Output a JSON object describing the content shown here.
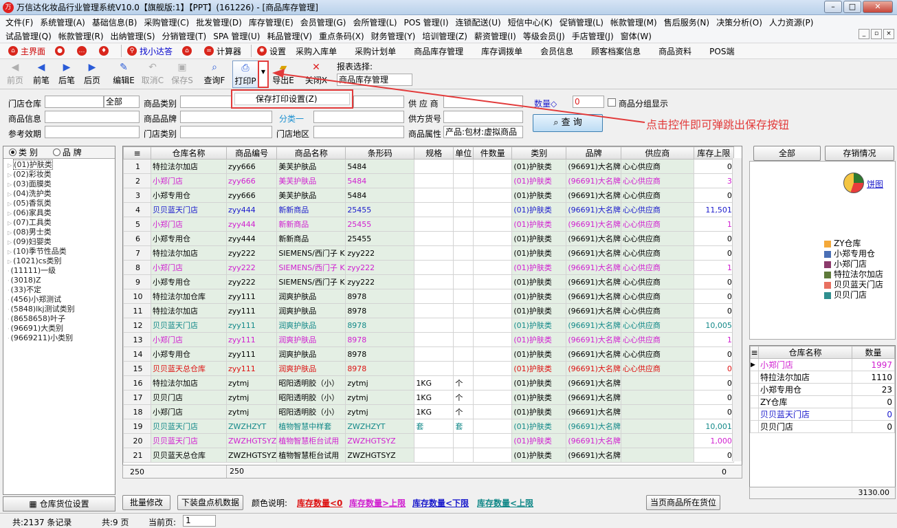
{
  "window": {
    "title": "万信达化妆品行业管理系统V10.0【旗舰版:1】【PPT】(161226) - [商品库存管理]",
    "logo_text": "万"
  },
  "menu_row1": [
    "文件(F)",
    "系统管理(A)",
    "基础信息(B)",
    "采购管理(C)",
    "批发管理(D)",
    "库存管理(E)",
    "会员管理(G)",
    "会所管理(L)",
    "POS 管理(I)",
    "连锁配送(U)",
    "短信中心(K)",
    "促销管理(L)",
    "帐款管理(M)",
    "售后服务(N)",
    "决策分析(O)",
    "人力资源(P)"
  ],
  "menu_row2": [
    "试品管理(Q)",
    "帐款管理(R)",
    "出纳管理(S)",
    "分销管理(T)",
    "SPA 管理(U)",
    "耗品管理(V)",
    "重点条码(X)",
    "财务管理(Y)",
    "培训管理(Z)",
    "薪资管理(I)",
    "等级会员(J)",
    "手店管理(J)",
    "窗体(W)"
  ],
  "quickbar": {
    "home": "主界面",
    "finder": "找小达答",
    "calc": "计算器",
    "settings": "设置",
    "links": [
      "采购入库单",
      "采购计划单",
      "商品库存管理",
      "库存调拨单",
      "会员信息",
      "顾客档案信息",
      "商品资料",
      "POS端"
    ]
  },
  "toolbar": {
    "first": "前页",
    "prev": "前笔",
    "next": "后笔",
    "last": "后页",
    "edit": "编辑E",
    "cancel": "取消C",
    "save": "保存S",
    "query": "查询F",
    "print": "打印P",
    "export": "导出E",
    "close": "关闭X",
    "report_label": "报表选择:",
    "report_value": "商品库存管理"
  },
  "popup": {
    "save_print": "保存打印设置(Z)"
  },
  "annotation": "点击控件即可弹跳出保存按钮",
  "form": {
    "store_label": "门店仓库",
    "store_scope": "全部",
    "cat_label": "商品类别",
    "supplier_label": "供 应 商",
    "qty_label": "数量◇",
    "qty_value": "0",
    "group_label": "商品分组显示",
    "info_label": "商品信息",
    "brand_label": "商品品牌",
    "class_link": "分类一",
    "supcode_label": "供方货号",
    "expiry_label": "参考效期",
    "storecat_label": "门店类别",
    "region_label": "门店地区",
    "attr_label": "商品属性",
    "attr_value": "产品:包材:虚拟商品",
    "query_btn": "查 询"
  },
  "left_panel": {
    "radio_category": "类 别",
    "radio_brand": "品 牌",
    "tree": [
      "(01)护肤类",
      "(02)彩妆类",
      "(03)面膜类",
      "(04)洗护类",
      "(05)香氛类",
      "(06)家具类",
      "(07)工具类",
      "(08)男士类",
      "(09)妇婴类",
      "(10)季节性品类",
      "(1021)cs类别",
      "(11111)一级",
      "(3018)Z",
      "(33)不定",
      "(456)小郑测试",
      "(5848)lkj测试类别",
      "(8658658)叶子",
      "(96691)大类别",
      "(9669211)小类别"
    ],
    "bottom_btn": "仓库货位设置"
  },
  "grid": {
    "columns": [
      "",
      "仓库名称",
      "商品编号",
      "商品名称",
      "条形码",
      "规格",
      "单位",
      "件数量",
      "类别",
      "品牌",
      "供应商",
      "库存上限"
    ],
    "rows": [
      {
        "n": "1",
        "store": "特拉法尔加店",
        "code": "zyy666",
        "name": "美芙护肤品",
        "bar": "5484",
        "spec": "",
        "unit": "",
        "pcs": "",
        "cat": "(01)护肤类",
        "brand": "(96691)大名牌",
        "sup": "心心供应商",
        "max": "0",
        "color": "#000000"
      },
      {
        "n": "2",
        "store": "小郑门店",
        "code": "zyy666",
        "name": "美芙护肤品",
        "bar": "5484",
        "spec": "",
        "unit": "",
        "pcs": "",
        "cat": "(01)护肤类",
        "brand": "(96691)大名牌",
        "sup": "心心供应商",
        "max": "3",
        "color": "#d020d0"
      },
      {
        "n": "3",
        "store": "小郑专用仓",
        "code": "zyy666",
        "name": "美芙护肤品",
        "bar": "5484",
        "spec": "",
        "unit": "",
        "pcs": "",
        "cat": "(01)护肤类",
        "brand": "(96691)大名牌",
        "sup": "心心供应商",
        "max": "0",
        "color": "#000000"
      },
      {
        "n": "4",
        "store": "贝贝蓝天门店",
        "code": "zyy444",
        "name": "新新商品",
        "bar": "25455",
        "spec": "",
        "unit": "",
        "pcs": "",
        "cat": "(01)护肤类",
        "brand": "(96691)大名牌",
        "sup": "心心供应商",
        "max": "11,501",
        "color": "#1a1acc"
      },
      {
        "n": "5",
        "store": "小郑门店",
        "code": "zyy444",
        "name": "新新商品",
        "bar": "25455",
        "spec": "",
        "unit": "",
        "pcs": "",
        "cat": "(01)护肤类",
        "brand": "(96691)大名牌",
        "sup": "心心供应商",
        "max": "1",
        "color": "#d020d0"
      },
      {
        "n": "6",
        "store": "小郑专用仓",
        "code": "zyy444",
        "name": "新新商品",
        "bar": "25455",
        "spec": "",
        "unit": "",
        "pcs": "",
        "cat": "(01)护肤类",
        "brand": "(96691)大名牌",
        "sup": "心心供应商",
        "max": "0",
        "color": "#000000"
      },
      {
        "n": "7",
        "store": "特拉法尔加店",
        "code": "zyy222",
        "name": "SIEMENS/西门子 K",
        "bar": "zyy222",
        "spec": "",
        "unit": "",
        "pcs": "",
        "cat": "(01)护肤类",
        "brand": "(96691)大名牌",
        "sup": "心心供应商",
        "max": "0",
        "color": "#000000"
      },
      {
        "n": "8",
        "store": "小郑门店",
        "code": "zyy222",
        "name": "SIEMENS/西门子 K",
        "bar": "zyy222",
        "spec": "",
        "unit": "",
        "pcs": "",
        "cat": "(01)护肤类",
        "brand": "(96691)大名牌",
        "sup": "心心供应商",
        "max": "1",
        "color": "#d020d0"
      },
      {
        "n": "9",
        "store": "小郑专用仓",
        "code": "zyy222",
        "name": "SIEMENS/西门子 K",
        "bar": "zyy222",
        "spec": "",
        "unit": "",
        "pcs": "",
        "cat": "(01)护肤类",
        "brand": "(96691)大名牌",
        "sup": "心心供应商",
        "max": "0",
        "color": "#000000"
      },
      {
        "n": "10",
        "store": "特拉法尔加仓库",
        "code": "zyy111",
        "name": "润爽护肤品",
        "bar": "8978",
        "spec": "",
        "unit": "",
        "pcs": "",
        "cat": "(01)护肤类",
        "brand": "(96691)大名牌",
        "sup": "心心供应商",
        "max": "0",
        "color": "#000000"
      },
      {
        "n": "11",
        "store": "特拉法尔加店",
        "code": "zyy111",
        "name": "润爽护肤品",
        "bar": "8978",
        "spec": "",
        "unit": "",
        "pcs": "",
        "cat": "(01)护肤类",
        "brand": "(96691)大名牌",
        "sup": "心心供应商",
        "max": "0",
        "color": "#000000"
      },
      {
        "n": "12",
        "store": "贝贝蓝天门店",
        "code": "zyy111",
        "name": "润爽护肤品",
        "bar": "8978",
        "spec": "",
        "unit": "",
        "pcs": "",
        "cat": "(01)护肤类",
        "brand": "(96691)大名牌",
        "sup": "心心供应商",
        "max": "10,005",
        "color": "#118888"
      },
      {
        "n": "13",
        "store": "小郑门店",
        "code": "zyy111",
        "name": "润爽护肤品",
        "bar": "8978",
        "spec": "",
        "unit": "",
        "pcs": "",
        "cat": "(01)护肤类",
        "brand": "(96691)大名牌",
        "sup": "心心供应商",
        "max": "1",
        "color": "#d020d0"
      },
      {
        "n": "14",
        "store": "小郑专用仓",
        "code": "zyy111",
        "name": "润爽护肤品",
        "bar": "8978",
        "spec": "",
        "unit": "",
        "pcs": "",
        "cat": "(01)护肤类",
        "brand": "(96691)大名牌",
        "sup": "心心供应商",
        "max": "0",
        "color": "#000000"
      },
      {
        "n": "15",
        "store": "贝贝蓝天总仓库",
        "code": "zyy111",
        "name": "润爽护肤品",
        "bar": "8978",
        "spec": "",
        "unit": "",
        "pcs": "",
        "cat": "(01)护肤类",
        "brand": "(96691)大名牌",
        "sup": "心心供应商",
        "max": "0",
        "color": "#dd1111"
      },
      {
        "n": "16",
        "store": "特拉法尔加店",
        "code": "zytmj",
        "name": "昭阳透明胶（小）",
        "bar": "zytmj",
        "spec": "1KG",
        "unit": "个",
        "pcs": "",
        "cat": "(01)护肤类",
        "brand": "(96691)大名牌",
        "sup": "",
        "max": "0",
        "color": "#000000"
      },
      {
        "n": "17",
        "store": "贝贝门店",
        "code": "zytmj",
        "name": "昭阳透明胶（小）",
        "bar": "zytmj",
        "spec": "1KG",
        "unit": "个",
        "pcs": "",
        "cat": "(01)护肤类",
        "brand": "(96691)大名牌",
        "sup": "",
        "max": "0",
        "color": "#000000"
      },
      {
        "n": "18",
        "store": "小郑门店",
        "code": "zytmj",
        "name": "昭阳透明胶（小）",
        "bar": "zytmj",
        "spec": "1KG",
        "unit": "个",
        "pcs": "",
        "cat": "(01)护肤类",
        "brand": "(96691)大名牌",
        "sup": "",
        "max": "0",
        "color": "#000000"
      },
      {
        "n": "19",
        "store": "贝贝蓝天门店",
        "code": "ZWZHZYT",
        "name": "植物智慧中样套",
        "bar": "ZWZHZYT",
        "spec": "套",
        "unit": "套",
        "pcs": "",
        "cat": "(01)护肤类",
        "brand": "(96691)大名牌",
        "sup": "",
        "max": "10,001",
        "color": "#118888"
      },
      {
        "n": "20",
        "store": "贝贝蓝天门店",
        "code": "ZWZHGTSYZ",
        "name": "植物智慧柜台试用",
        "bar": "ZWZHGTSYZ",
        "spec": "",
        "unit": "",
        "pcs": "",
        "cat": "(01)护肤类",
        "brand": "(96691)大名牌",
        "sup": "",
        "max": "1,000",
        "color": "#d020d0"
      },
      {
        "n": "21",
        "store": "贝贝蓝天总仓库",
        "code": "ZWZHGTSYZ",
        "name": "植物智慧柜台试用",
        "bar": "ZWZHGTSYZ",
        "spec": "",
        "unit": "",
        "pcs": "",
        "cat": "(01)护肤类",
        "brand": "(96691)大名牌",
        "sup": "",
        "max": "0",
        "color": "#000000"
      }
    ],
    "footer_count": "250",
    "footer_code": "250",
    "footer_max": "0"
  },
  "bottom_tools": {
    "batch_edit": "批量修改",
    "download": "下装盘点机数据",
    "legend_title": "颜色说明:",
    "legend": [
      {
        "label": "库存数量<0",
        "color": "#dd1111"
      },
      {
        "label": "库存数量>上限",
        "color": "#d020d0"
      },
      {
        "label": "库存数量<下限",
        "color": "#1a1acc"
      },
      {
        "label": "库存数量<上限",
        "color": "#118888"
      }
    ],
    "location_btn": "当页商品所在货位"
  },
  "right_panel": {
    "tab_all": "全部",
    "tab_stock": "存销情况",
    "pie_link": "饼图",
    "legend": [
      {
        "label": "ZY仓库",
        "color": "#f4a93a"
      },
      {
        "label": "小郑专用仓",
        "color": "#4a6fb5"
      },
      {
        "label": "小郑门店",
        "color": "#8b3a6b"
      },
      {
        "label": "特拉法尔加店",
        "color": "#5e7a3a"
      },
      {
        "label": "贝贝蓝天门店",
        "color": "#e87060"
      },
      {
        "label": "贝贝门店",
        "color": "#2f8f8f"
      }
    ],
    "columns": [
      "仓库名称",
      "数量"
    ],
    "rows": [
      {
        "name": "小郑门店",
        "qty": "1997",
        "color": "#d020d0"
      },
      {
        "name": "特拉法尔加店",
        "qty": "1110",
        "color": "#000000"
      },
      {
        "name": "小郑专用仓",
        "qty": "23",
        "color": "#000000"
      },
      {
        "name": "ZY仓库",
        "qty": "0",
        "color": "#000000"
      },
      {
        "name": "贝贝蓝天门店",
        "qty": "0",
        "color": "#1a1acc"
      },
      {
        "name": "贝贝门店",
        "qty": "0",
        "color": "#000000"
      }
    ],
    "total": "3130.00"
  },
  "status": {
    "records": "共:2137 条记录",
    "pages": "共:9 页",
    "current_label": "当前页:",
    "current_value": "1"
  }
}
